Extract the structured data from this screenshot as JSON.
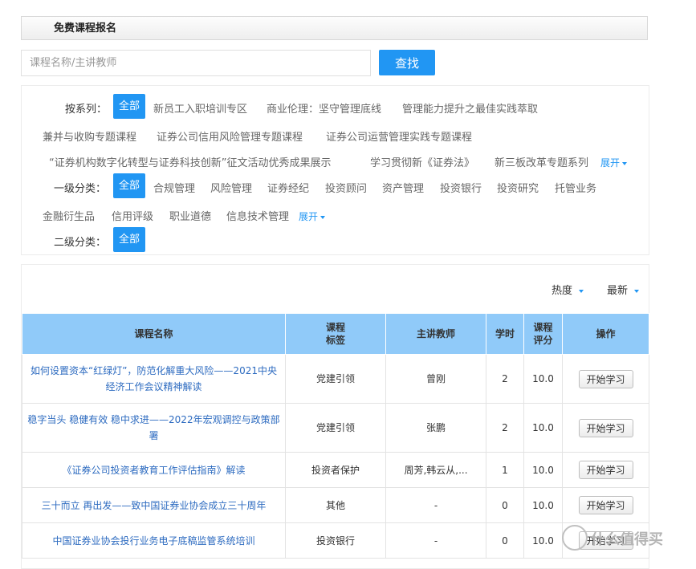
{
  "header": {
    "title": "免费课程报名"
  },
  "search": {
    "placeholder": "课程名称/主讲教师",
    "button_label": "查找"
  },
  "filters": {
    "series": {
      "label": "按系列：",
      "all": "全部",
      "items": [
        "新员工入职培训专区",
        "商业伦理：坚守管理底线",
        "管理能力提升之最佳实践萃取",
        "兼并与收购专题课程",
        "证券公司信用风险管理专题课程",
        "证券公司运营管理实践专题课程",
        "“证券机构数字化转型与证券科技创新”征文活动优秀成果展示",
        "学习贯彻新《证券法》",
        "新三板改革专题系列"
      ],
      "expand": "展开"
    },
    "level1": {
      "label": "一级分类：",
      "all": "全部",
      "items": [
        "合规管理",
        "风险管理",
        "证券经纪",
        "投资顾问",
        "资产管理",
        "投资银行",
        "投资研究",
        "托管业务",
        "金融衍生品",
        "信用评级",
        "职业道德",
        "信息技术管理"
      ],
      "expand": "展开"
    },
    "level2": {
      "label": "二级分类：",
      "all": "全部"
    }
  },
  "sort": {
    "hot": "热度",
    "latest": "最新"
  },
  "table": {
    "headers": {
      "name": "课程名称",
      "tag": "课程\n标签",
      "teacher": "主讲教师",
      "hours": "学时",
      "score": "课程\n评分",
      "action": "操作"
    },
    "rows": [
      {
        "name": "如何设置资本“红绿灯”，防范化解重大风险——2021中央经济工作会议精神解读",
        "tag": "党建引领",
        "teacher": "曾刚",
        "hours": "2",
        "score": "10.0",
        "action": "开始学习"
      },
      {
        "name": "稳字当头 稳健有效 稳中求进——2022年宏观调控与政策部署",
        "tag": "党建引领",
        "teacher": "张鹏",
        "hours": "2",
        "score": "10.0",
        "action": "开始学习"
      },
      {
        "name": "《证券公司投资者教育工作评估指南》解读",
        "tag": "投资者保护",
        "teacher": "周芳,韩云从,...",
        "hours": "1",
        "score": "10.0",
        "action": "开始学习"
      },
      {
        "name": "三十而立 再出发——致中国证券业协会成立三十周年",
        "tag": "其他",
        "teacher": "-",
        "hours": "0",
        "score": "10.0",
        "action": "开始学习"
      },
      {
        "name": "中国证券业协会投行业务电子底稿监管系统培训",
        "tag": "投资银行",
        "teacher": "-",
        "hours": "0",
        "score": "10.0",
        "action": "开始学习"
      }
    ]
  },
  "watermark": {
    "text": "什么值得买"
  },
  "colors": {
    "accent": "#2196f3",
    "table_header": "#90caf9",
    "link": "#2d6bc0"
  }
}
